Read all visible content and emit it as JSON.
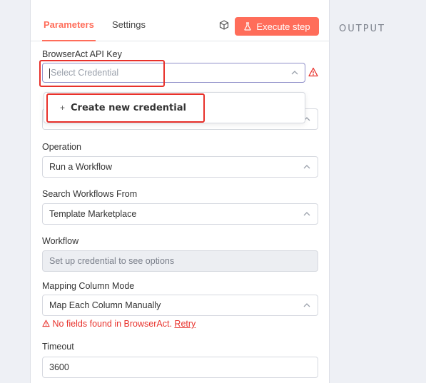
{
  "tabs": {
    "parameters": "Parameters",
    "settings": "Settings"
  },
  "toolbar": {
    "execute_label": "Execute step"
  },
  "output": {
    "label": "OUTPUT"
  },
  "credential": {
    "label": "BrowserAct API Key",
    "placeholder": "Select Credential",
    "dropdown_item": "Create new credential"
  },
  "operation": {
    "label": "Operation",
    "value": "Run a Workflow"
  },
  "search_from": {
    "label": "Search Workflows From",
    "value": "Template Marketplace"
  },
  "workflow": {
    "label": "Workflow",
    "value": "Set up credential to see options"
  },
  "mapping": {
    "label": "Mapping Column Mode",
    "value": "Map Each Column Manually",
    "error_text": "No fields found in BrowserAct.",
    "retry_label": "Retry"
  },
  "timeout": {
    "label": "Timeout",
    "value": "3600"
  },
  "colors": {
    "accent": "#ff6d5a",
    "error": "#e8312b",
    "highlight_box": "#e8312b"
  },
  "icons": {
    "execute": "flask-icon",
    "node": "cube-icon",
    "warning": "warning-icon",
    "chevron": "chevron-up-icon",
    "add": "plus-icon"
  }
}
